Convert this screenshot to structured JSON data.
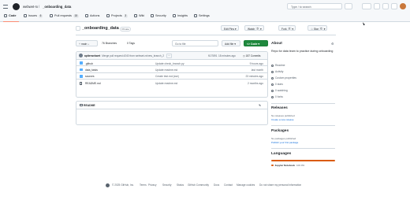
{
  "header": {
    "owner": "webwet-rx",
    "separator": "/",
    "repo": "_onboarding_data",
    "search_placeholder": "Type / to search"
  },
  "tabs": [
    {
      "label": "Code",
      "count": ""
    },
    {
      "label": "Issues",
      "count": "6"
    },
    {
      "label": "Pull requests",
      "count": "15"
    },
    {
      "label": "Actions",
      "count": ""
    },
    {
      "label": "Projects",
      "count": "3"
    },
    {
      "label": "Wiki",
      "count": ""
    },
    {
      "label": "Security",
      "count": ""
    },
    {
      "label": "Insights",
      "count": ""
    },
    {
      "label": "Settings",
      "count": ""
    }
  ],
  "repo": {
    "title": "_onboarding_data",
    "visibility": "Private",
    "edit_pins": "Edit Pins",
    "watch": "Watch",
    "watch_count": "0",
    "fork": "Fork",
    "fork_count": "0",
    "star": "Star",
    "star_count": "0"
  },
  "toolbar": {
    "branch": "main",
    "branches": "76 Branches",
    "tags": "0 Tags",
    "goto_placeholder": "Go to file",
    "add_file": "Add file",
    "code": "Code"
  },
  "commit": {
    "author": "apiterwebwet",
    "message": "Merge pull request #240 from webwet-rx/new_branch_2",
    "sha": "f107891",
    "time": "18 minutes ago",
    "commits": "187 Commits"
  },
  "files": [
    {
      "name": ".github",
      "message": "Update check_branch.py",
      "date": "9 hours ago",
      "type": "folder"
    },
    {
      "name": "data_tasks",
      "message": "Update readme.md",
      "date": "last month",
      "type": "folder"
    },
    {
      "name": "sources",
      "message": "Create test.md (sse)",
      "date": "23 minutes ago",
      "type": "folder"
    },
    {
      "name": "README.md",
      "message": "Update readme.md",
      "date": "2 months ago",
      "type": "file"
    }
  ],
  "readme_label": "README",
  "about": {
    "title": "About",
    "description": "Repo for data team to practice during onboarding",
    "items": [
      "Readme",
      "Activity",
      "Custom properties",
      "0 stars",
      "0 watching",
      "0 forks"
    ]
  },
  "releases": {
    "title": "Releases",
    "none": "No releases published",
    "link": "Create a new release"
  },
  "packages": {
    "title": "Packages",
    "none": "No packages published",
    "link": "Publish your first package"
  },
  "languages": {
    "title": "Languages",
    "name": "Jupyter Notebook",
    "percent": "100.0%",
    "color": "#DA5B0B",
    "share": 1.0
  },
  "footer": {
    "copyright": "© 2025 GitHub, Inc.",
    "links": [
      "Terms",
      "Privacy",
      "Security",
      "Status",
      "GitHub Community",
      "Docs",
      "Contact",
      "Manage cookies",
      "Do not share my personal information"
    ]
  }
}
